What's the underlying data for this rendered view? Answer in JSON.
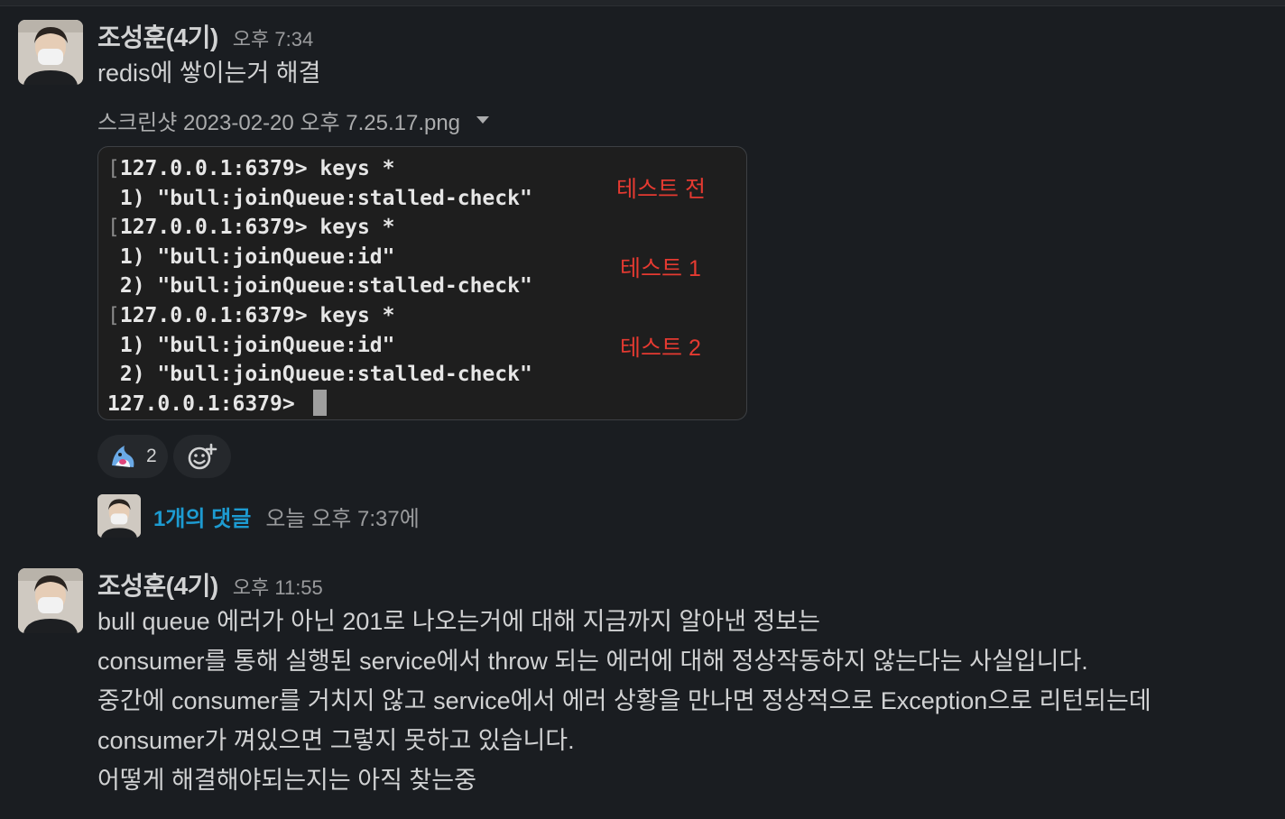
{
  "messages": [
    {
      "author": "조성훈(4기)",
      "time": "오후 7:34",
      "text": "redis에 쌓이는거 해결",
      "attachment": {
        "filename": "스크린샷 2023-02-20 오후 7.25.17.png",
        "terminal_lines": [
          "127.0.0.1:6379> keys *",
          " 1) \"bull:joinQueue:stalled-check\"",
          "127.0.0.1:6379> keys *",
          " 1) \"bull:joinQueue:id\"",
          " 2) \"bull:joinQueue:stalled-check\"",
          "127.0.0.1:6379> keys *",
          " 1) \"bull:joinQueue:id\"",
          " 2) \"bull:joinQueue:stalled-check\"",
          "127.0.0.1:6379> "
        ],
        "annotations": [
          "테스트 전",
          "테스트 1",
          "테스트 2"
        ],
        "annotation_color": "#e53a31"
      },
      "reactions": [
        {
          "emoji": "shark-emoji",
          "count": "2"
        },
        {
          "emoji": "add-reaction-icon"
        }
      ],
      "thread": {
        "replies": "1개의 댓글",
        "last_reply": "오늘 오후 7:37에"
      }
    },
    {
      "author": "조성훈(4기)",
      "time": "오후 11:55",
      "lines": [
        "bull queue 에러가 아닌 201로 나오는거에 대해 지금까지 알아낸 정보는",
        "consumer를 통해 실행된 service에서 throw 되는 에러에 대해 정상작동하지 않는다는 사실입니다.",
        "중간에 consumer를 거치지 않고 service에서 에러 상황을 만나면 정상적으로 Exception으로 리턴되는데",
        "consumer가 껴있으면 그렇지 못하고 있습니다.",
        "어떻게 해결해야되는지는 아직 찾는중"
      ]
    }
  ],
  "colors": {
    "background": "#1a1d21",
    "link": "#1d9bd1",
    "text": "#d1d2d3",
    "muted": "#9a9b9d"
  }
}
